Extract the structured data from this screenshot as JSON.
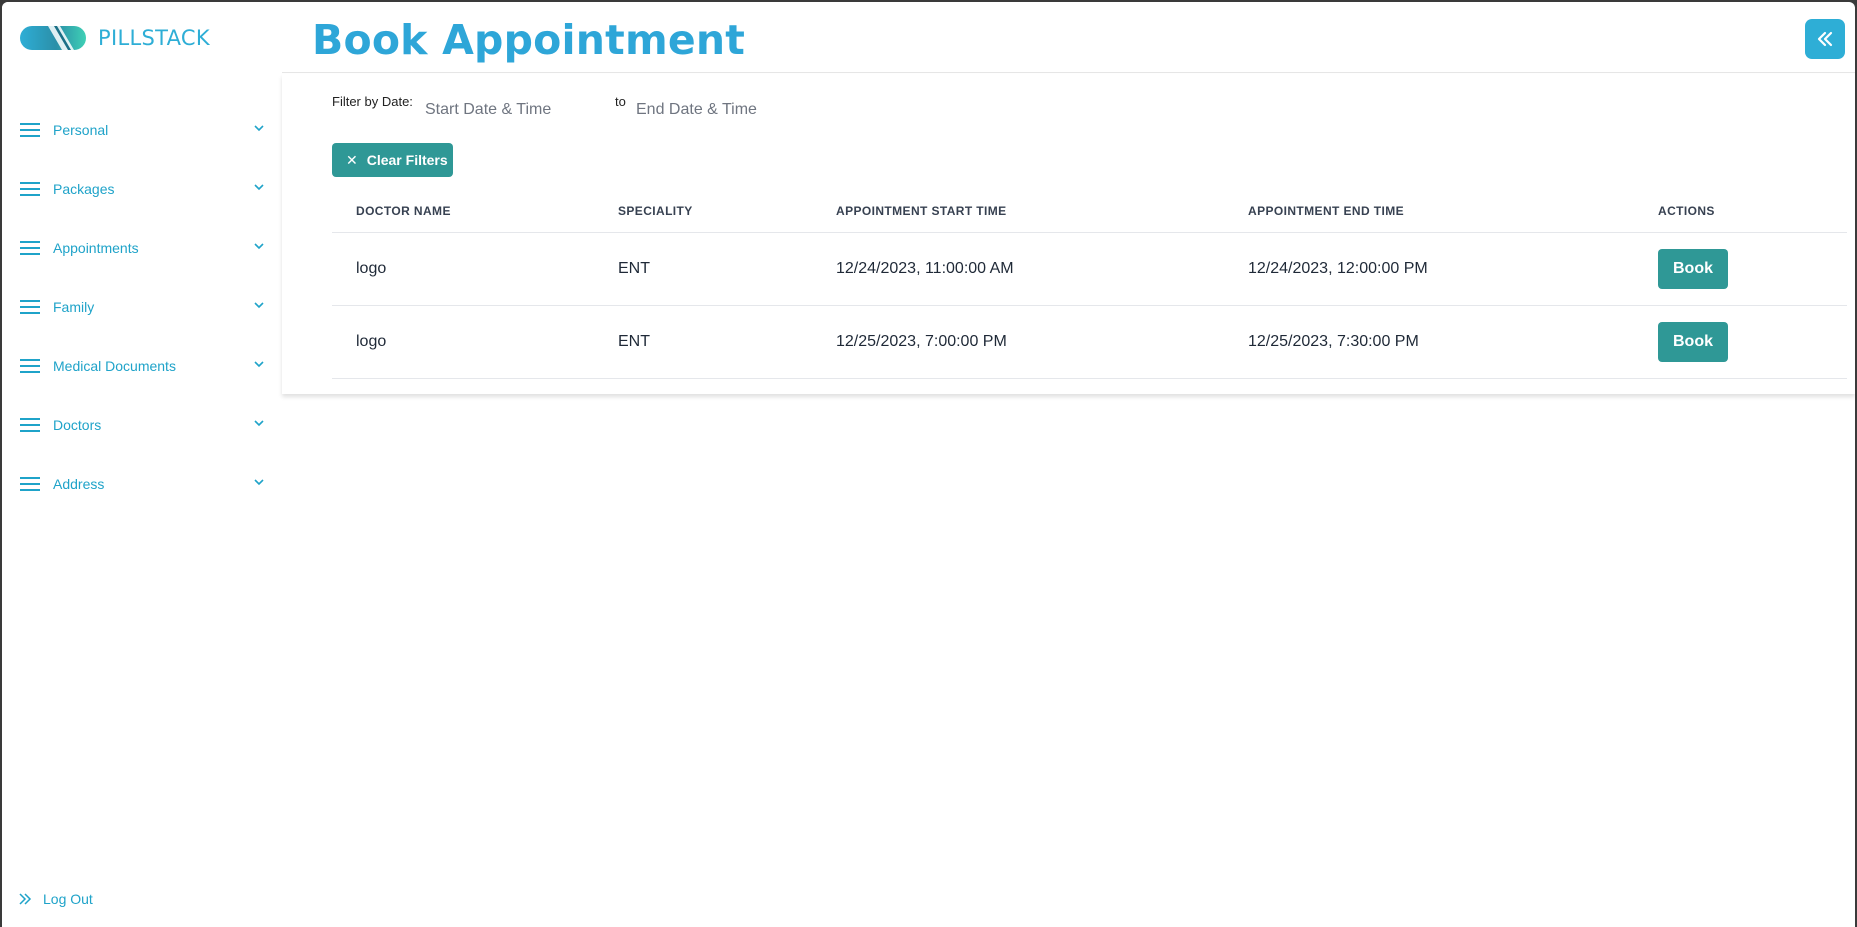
{
  "brand": {
    "name": "PILLSTACK",
    "logo_icon": "pill-logo-icon"
  },
  "colors": {
    "accent": "#2eaed6",
    "teal": "#2f9896",
    "menu_text": "#1fa3c9"
  },
  "sidebar": {
    "items": [
      {
        "label": "Personal",
        "icon": "hamburger-icon"
      },
      {
        "label": "Packages",
        "icon": "hamburger-icon"
      },
      {
        "label": "Appointments",
        "icon": "hamburger-icon"
      },
      {
        "label": "Family",
        "icon": "hamburger-icon"
      },
      {
        "label": "Medical Documents",
        "icon": "hamburger-icon"
      },
      {
        "label": "Doctors",
        "icon": "hamburger-icon"
      },
      {
        "label": "Address",
        "icon": "hamburger-icon"
      }
    ],
    "logout_label": "Log Out"
  },
  "header": {
    "title": "Book Appointment",
    "collapse_icon": "double-chevron-left-icon"
  },
  "filter": {
    "label": "Filter by Date:",
    "start_placeholder": "Start Date & Time",
    "to_label": "to",
    "end_placeholder": "End Date & Time",
    "clear_label": "Clear Filters"
  },
  "table": {
    "columns": [
      "DOCTOR NAME",
      "SPECIALITY",
      "APPOINTMENT START TIME",
      "APPOINTMENT END TIME",
      "ACTIONS"
    ],
    "rows": [
      {
        "doctor": "logo",
        "speciality": "ENT",
        "start": "12/24/2023, 11:00:00 AM",
        "end": "12/24/2023, 12:00:00 PM",
        "action": "Book"
      },
      {
        "doctor": "logo",
        "speciality": "ENT",
        "start": "12/25/2023, 7:00:00 PM",
        "end": "12/25/2023, 7:30:00 PM",
        "action": "Book"
      }
    ]
  }
}
